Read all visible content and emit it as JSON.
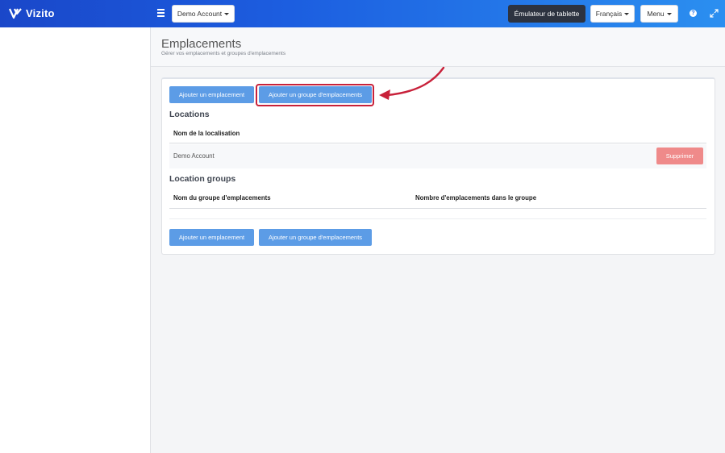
{
  "topbar": {
    "brand": "Vizito",
    "account_label": "Demo Account",
    "emulator_label": "Émulateur de tablette",
    "language_label": "Français",
    "menu_label": "Menu",
    "help_glyph": "?"
  },
  "header": {
    "title": "Emplacements",
    "subtitle": "Gérer vos emplacements et groupes d'emplacements"
  },
  "actions": {
    "add_location": "Ajouter un emplacement",
    "add_location_group": "Ajouter un groupe d'emplacements"
  },
  "locations": {
    "title": "Locations",
    "columns": [
      "Nom de la localisation"
    ],
    "rows": [
      {
        "name": "Demo Account",
        "delete_label": "Supprimer"
      }
    ]
  },
  "location_groups": {
    "title": "Location groups",
    "columns": [
      "Nom du groupe d'emplacements",
      "Nombre d'emplacements dans le groupe"
    ],
    "rows": []
  },
  "colors": {
    "primary_button": "#5c9ce6",
    "delete_button": "#ef8a8a",
    "highlight": "#c8213a",
    "dark_button": "#2d3340"
  }
}
